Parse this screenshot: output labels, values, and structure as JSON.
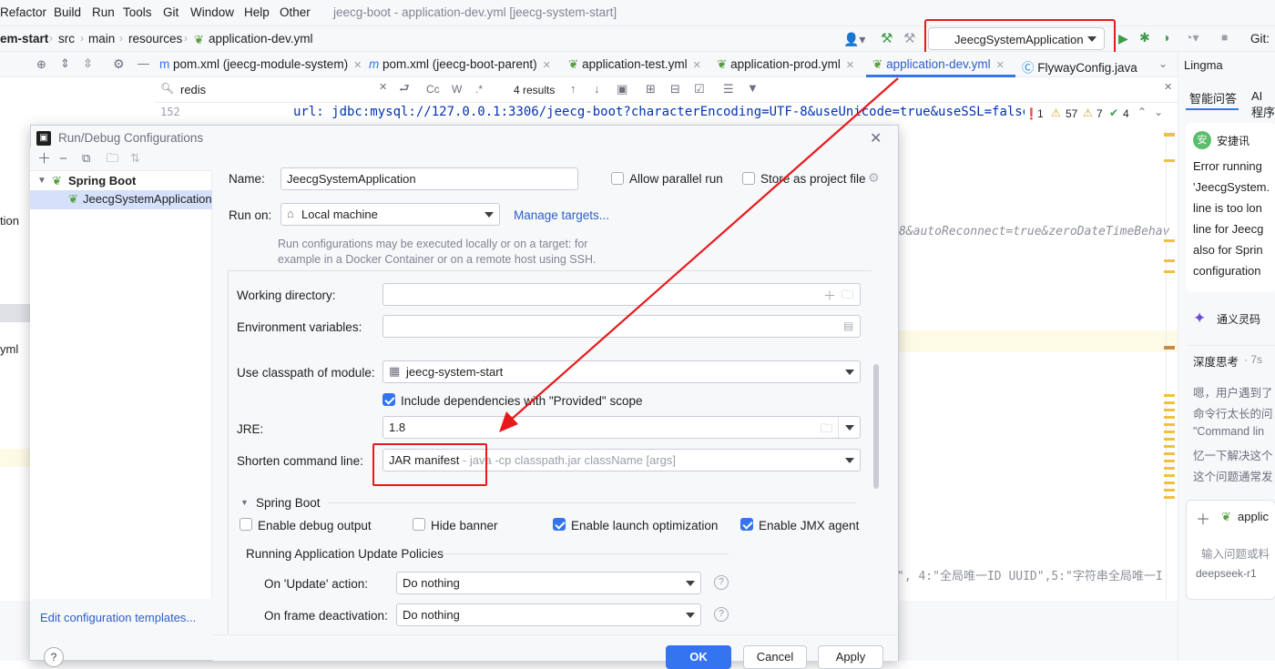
{
  "window_title": "jeecg-boot - application-dev.yml [jeecg-system-start]",
  "menu": [
    "Refactor",
    "Build",
    "Run",
    "Tools",
    "Git",
    "Window",
    "Help",
    "Other"
  ],
  "breadcrumb": [
    "em-start",
    "src",
    "main",
    "resources",
    "application-dev.yml"
  ],
  "run_config": {
    "name": "JeecgSystemApplication",
    "git_label": "Git:"
  },
  "file_tabs": [
    "pom.xml (jeecg-module-system)",
    "pom.xml (jeecg-boot-parent)",
    "application-test.yml",
    "application-prod.yml",
    "application-dev.yml",
    "FlywayConfig.java"
  ],
  "find": {
    "query": "redis",
    "results": "4 results",
    "cc": "Cc",
    "w": "W",
    "regex": ".*"
  },
  "editor": {
    "line_number": "152",
    "line_152": "url: jdbc:mysql://127.0.0.1:3306/jeecg-boot?characterEncoding=UTF-8&useUnicode=true&useSSL=false&ti",
    "line_b": "8&autoReconnect=true&zeroDateTimeBehav",
    "line_c": "\", 4:\"全局唯一ID UUID\",5:\"字符串全局唯一I",
    "inspections": {
      "errors": "1",
      "warnings": "57",
      "weak": "7",
      "checks": "4"
    }
  },
  "left_partial": [
    "tion",
    "yml"
  ],
  "right_panel": {
    "title": "Lingma",
    "tab1": "智能问答",
    "tab2": "AI 程序",
    "user": "安捷讯",
    "message": [
      "Error running",
      "'JeecgSystem.",
      "line is too lon",
      "line for Jeecg",
      "also for Sprin",
      "configuration"
    ],
    "bot": "通义灵码",
    "think": "深度思考",
    "think_time": "· 7s",
    "bot_lines": [
      "嗯，用户遇到了",
      "命令行太长的问",
      "\"Command lin",
      "忆一下解决这个",
      "这个问题通常发"
    ],
    "chip": "applic",
    "input_placeholder": "输入问题或料",
    "model": "deepseek-r1"
  },
  "dialog": {
    "title": "Run/Debug Configurations",
    "tree_root": "Spring Boot",
    "tree_child": "JeecgSystemApplication",
    "name_label": "Name:",
    "name_value": "JeecgSystemApplication",
    "allow_parallel": "Allow parallel run",
    "store_project": "Store as project file",
    "run_on_label": "Run on:",
    "run_on_value": "Local machine",
    "manage_targets": "Manage targets...",
    "run_on_hint1": "Run configurations may be executed locally or on a target: for",
    "run_on_hint2": "example in a Docker Container or on a remote host using SSH.",
    "working_dir_label": "Working directory:",
    "env_vars_label": "Environment variables:",
    "classpath_label": "Use classpath of module:",
    "classpath_value": "jeecg-system-start",
    "include_deps": "Include dependencies with \"Provided\" scope",
    "jre_label": "JRE:",
    "jre_value": "1.8",
    "shorten_label": "Shorten command line:",
    "shorten_value": "JAR manifest",
    "shorten_hint": " - java -cp classpath.jar className [args]",
    "spring_boot_section": "Spring Boot",
    "debug_output": "Enable debug output",
    "hide_banner": "Hide banner",
    "launch_opt": "Enable launch optimization",
    "jmx_agent": "Enable JMX agent",
    "update_policies": "Running Application Update Policies",
    "on_update_label": "On 'Update' action:",
    "on_update_value": "Do nothing",
    "on_frame_label": "On frame deactivation:",
    "on_frame_value": "Do nothing",
    "edit_templates": "Edit configuration templates...",
    "help": "?",
    "ok": "OK",
    "cancel": "Cancel",
    "apply": "Apply"
  }
}
